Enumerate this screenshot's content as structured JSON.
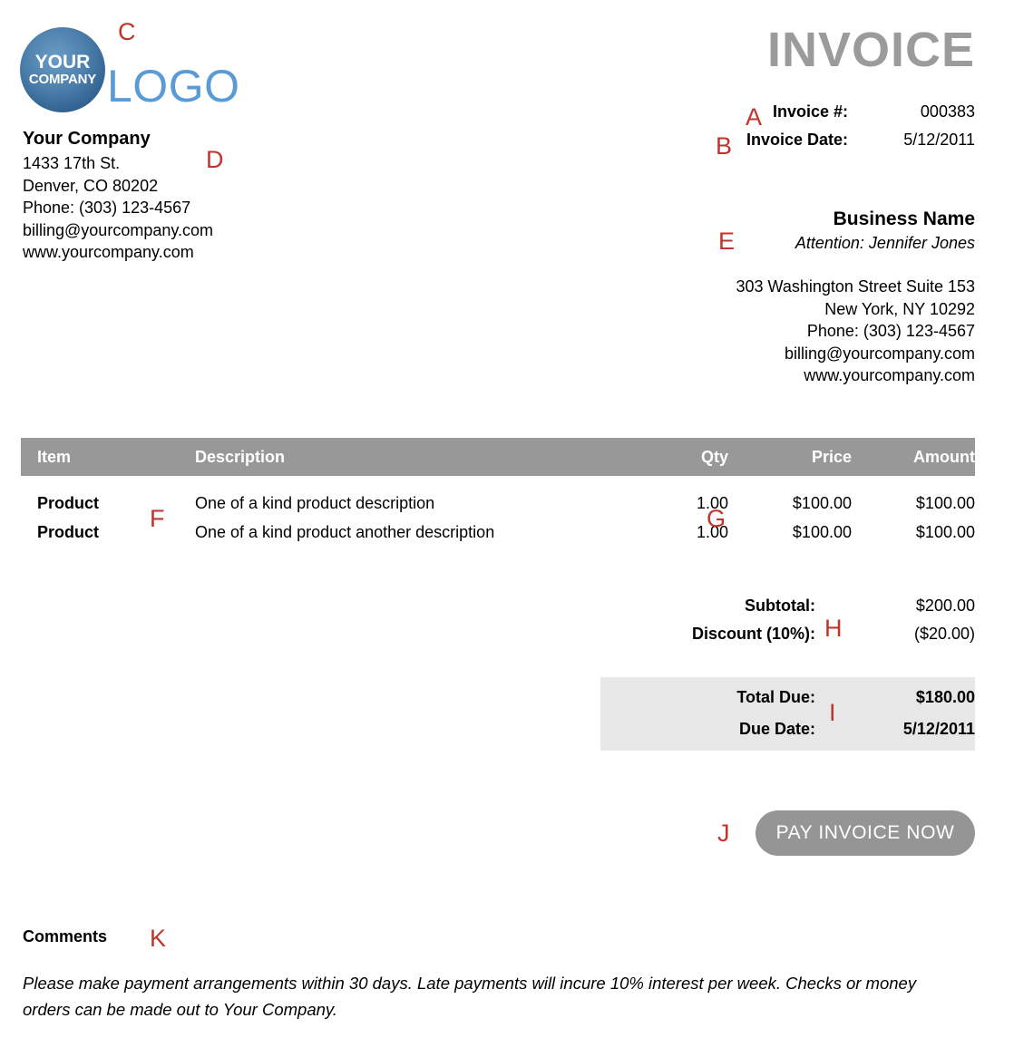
{
  "document": {
    "title": "INVOICE",
    "type": "invoice"
  },
  "logo": {
    "circle_line1": "YOUR",
    "circle_line2": "COMPANY",
    "wordmark": "LOGO",
    "circle_color": "#3a6d9a",
    "wordmark_color": "#5b9bd5"
  },
  "meta": {
    "invoice_number_label": "Invoice #:",
    "invoice_number_value": "000383",
    "invoice_date_label": "Invoice Date:",
    "invoice_date_value": "5/12/2011"
  },
  "sender": {
    "name": "Your Company",
    "street": "1433 17th St.",
    "city_state_zip": "Denver, CO 80202",
    "phone": "Phone: (303) 123-4567",
    "email": "billing@yourcompany.com",
    "website": "www.yourcompany.com"
  },
  "recipient": {
    "name": "Business Name",
    "attention": "Attention: Jennifer Jones",
    "street": "303 Washington Street Suite 153",
    "city_state_zip": "New York, NY 10292",
    "phone": "Phone: (303) 123-4567",
    "email": "billing@yourcompany.com",
    "website": "www.yourcompany.com"
  },
  "table": {
    "headers": {
      "item": "Item",
      "description": "Description",
      "qty": "Qty",
      "price": "Price",
      "amount": "Amount"
    },
    "rows": [
      {
        "item": "Product",
        "description": "One of a kind product description",
        "qty": "1.00",
        "price": "$100.00",
        "amount": "$100.00"
      },
      {
        "item": "Product",
        "description": "One of a kind product another description",
        "qty": "1.00",
        "price": "$100.00",
        "amount": "$100.00"
      }
    ]
  },
  "totals": {
    "subtotal_label": "Subtotal:",
    "subtotal_value": "$200.00",
    "discount_label": "Discount (10%):",
    "discount_value": "($20.00)",
    "total_due_label": "Total Due:",
    "total_due_value": "$180.00",
    "due_date_label": "Due Date:",
    "due_date_value": "5/12/2011"
  },
  "actions": {
    "pay_button_label": "PAY INVOICE NOW"
  },
  "comments": {
    "title": "Comments",
    "body": "Please make payment arrangements within 30 days. Late payments will incure 10% interest per week. Checks or money orders can be made out to Your Company."
  },
  "markers": {
    "a": "A",
    "b": "B",
    "c": "C",
    "d": "D",
    "e": "E",
    "f": "F",
    "g": "G",
    "h": "H",
    "i": "I",
    "j": "J",
    "k": "K",
    "color": "#c0342b"
  }
}
